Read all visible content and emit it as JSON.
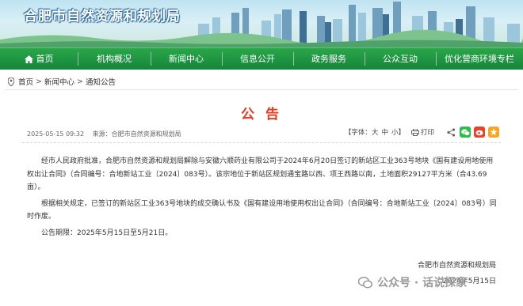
{
  "site": {
    "title": "合肥市自然资源和规划局"
  },
  "nav": {
    "items": [
      {
        "label": "首页",
        "icon": "home-icon"
      },
      {
        "label": "机构概况"
      },
      {
        "label": "新闻中心"
      },
      {
        "label": "信息公开"
      },
      {
        "label": "政务服务"
      },
      {
        "label": "公众互动"
      },
      {
        "label": "优化营商环境专栏"
      }
    ]
  },
  "breadcrumb": {
    "items": [
      "首页",
      "新闻中心",
      "通知公告"
    ],
    "separator": ">"
  },
  "article": {
    "title": "公 告",
    "date": "2025-05-15 09:32",
    "source": "来源：合肥市自然资源和规划局",
    "font_label": "【字体：",
    "font_large": "大",
    "font_medium": "中",
    "font_small": "小",
    "font_close": "】",
    "print_label": "打印",
    "paragraphs": [
      "经市人民政府批准，合肥市自然资源和规划局解除与安徽六顺药业有限公司于2024年6月20日签订的新站区工业363号地块《国有建设用地使用权出让合同》（合同编号：合地新站工业〔2024〕083号）。该宗地位于新站区规划通宝路以西、项王西路以南，土地面积29127平方米（合43.69亩）。",
      "根据相关规定，已签订的新站区工业363号地块的成交确认书及《国有建设用地使用权出让合同》（合同编号：合地新站工业〔2024〕083号）同时作废。",
      "公告期限：2025年5月15日至5月21日。"
    ],
    "sign_org": "合肥市自然资源和规划局",
    "sign_date": "2024年5月15日"
  },
  "watermark": {
    "text": "公众号 · 话说探家"
  },
  "colors": {
    "nav_green": "#1e9a43",
    "title_red": "#e63b1f",
    "wechat": "#2dbb4a",
    "weibo": "#e8412c",
    "qzone": "#f5a623"
  }
}
